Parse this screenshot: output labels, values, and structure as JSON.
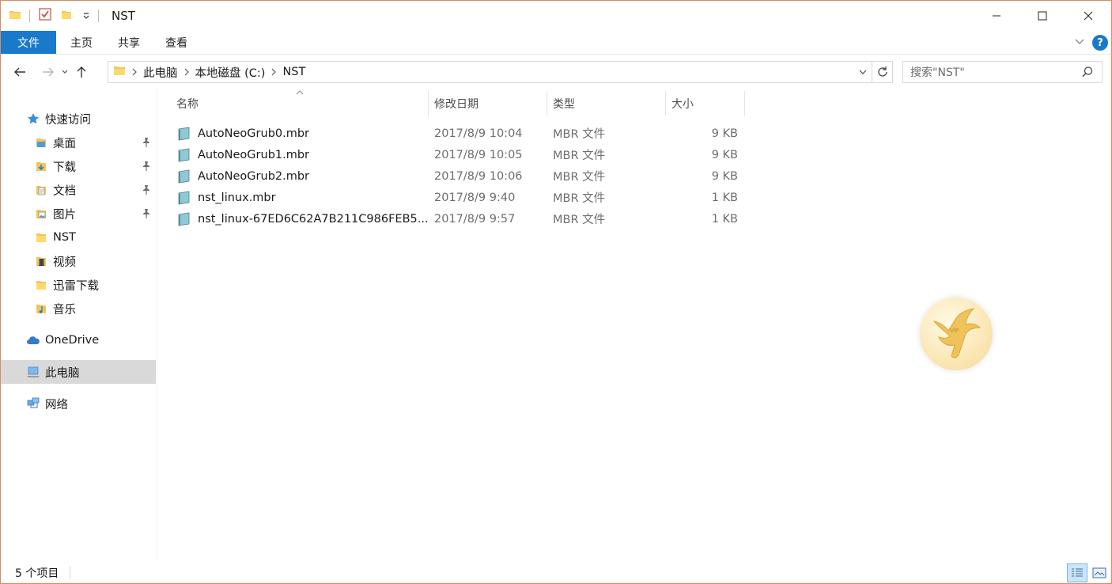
{
  "window": {
    "title": "NST",
    "border_color": "#d98c5f"
  },
  "ribbon": {
    "tabs": [
      "文件",
      "主页",
      "共享",
      "查看"
    ],
    "help_label": "?",
    "file_tab_color": "#1979ca"
  },
  "navigation": {
    "breadcrumbs": [
      "此电脑",
      "本地磁盘 (C:)",
      "NST"
    ],
    "search_placeholder": "搜索\"NST\""
  },
  "sidebar": {
    "quick_access": "快速访问",
    "items": [
      {
        "label": "桌面",
        "icon": "desktop-folder-icon",
        "pinned": true
      },
      {
        "label": "下载",
        "icon": "downloads-folder-icon",
        "pinned": true
      },
      {
        "label": "文档",
        "icon": "documents-folder-icon",
        "pinned": true
      },
      {
        "label": "图片",
        "icon": "pictures-folder-icon",
        "pinned": true
      },
      {
        "label": "NST",
        "icon": "folder-icon",
        "pinned": false
      },
      {
        "label": "视频",
        "icon": "videos-folder-icon",
        "pinned": false
      },
      {
        "label": "迅雷下载",
        "icon": "folder-icon",
        "pinned": false
      },
      {
        "label": "音乐",
        "icon": "music-folder-icon",
        "pinned": false
      }
    ],
    "onedrive": "OneDrive",
    "this_pc": "此电脑",
    "network": "网络"
  },
  "columns": {
    "name": "名称",
    "date": "修改日期",
    "type": "类型",
    "size": "大小"
  },
  "files": [
    {
      "name": "AutoNeoGrub0.mbr",
      "date": "2017/8/9 10:04",
      "type": "MBR 文件",
      "size": "9 KB"
    },
    {
      "name": "AutoNeoGrub1.mbr",
      "date": "2017/8/9 10:05",
      "type": "MBR 文件",
      "size": "9 KB"
    },
    {
      "name": "AutoNeoGrub2.mbr",
      "date": "2017/8/9 10:06",
      "type": "MBR 文件",
      "size": "9 KB"
    },
    {
      "name": "nst_linux.mbr",
      "date": "2017/8/9 9:40",
      "type": "MBR 文件",
      "size": "1 KB"
    },
    {
      "name": "nst_linux-67ED6C62A7B211C986FEB5...",
      "date": "2017/8/9 9:57",
      "type": "MBR 文件",
      "size": "1 KB"
    }
  ],
  "widget": {
    "badge": "VIP"
  },
  "status": {
    "item_count": "5 个项目"
  }
}
